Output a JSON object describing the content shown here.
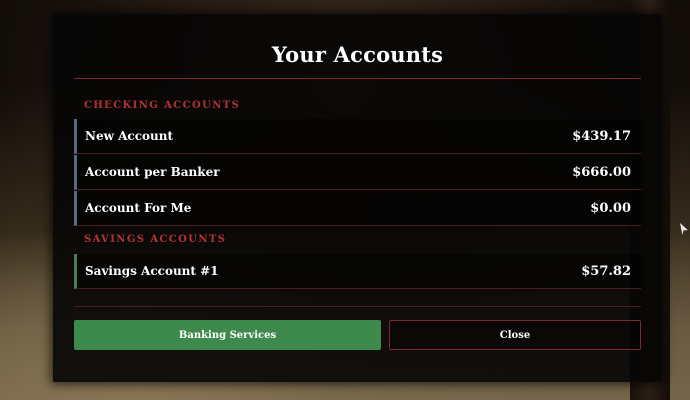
{
  "modal": {
    "title": "Your Accounts",
    "checking": {
      "label": "CHECKING ACCOUNTS",
      "accounts": [
        {
          "name": "New Account",
          "balance": "$439.17"
        },
        {
          "name": "Account per Banker",
          "balance": "$666.00"
        },
        {
          "name": "Account For Me",
          "balance": "$0.00"
        }
      ]
    },
    "savings": {
      "label": "SAVINGS ACCOUNTS",
      "accounts": [
        {
          "name": "Savings Account #1",
          "balance": "$57.82"
        }
      ]
    },
    "buttons": {
      "banking_services": "Banking Services",
      "close": "Close"
    }
  },
  "colors": {
    "accent_red": "#b5332f",
    "primary_button": "#3e8a4d",
    "checking_bar": "#5a6a82",
    "savings_bar": "#4f7a55"
  }
}
